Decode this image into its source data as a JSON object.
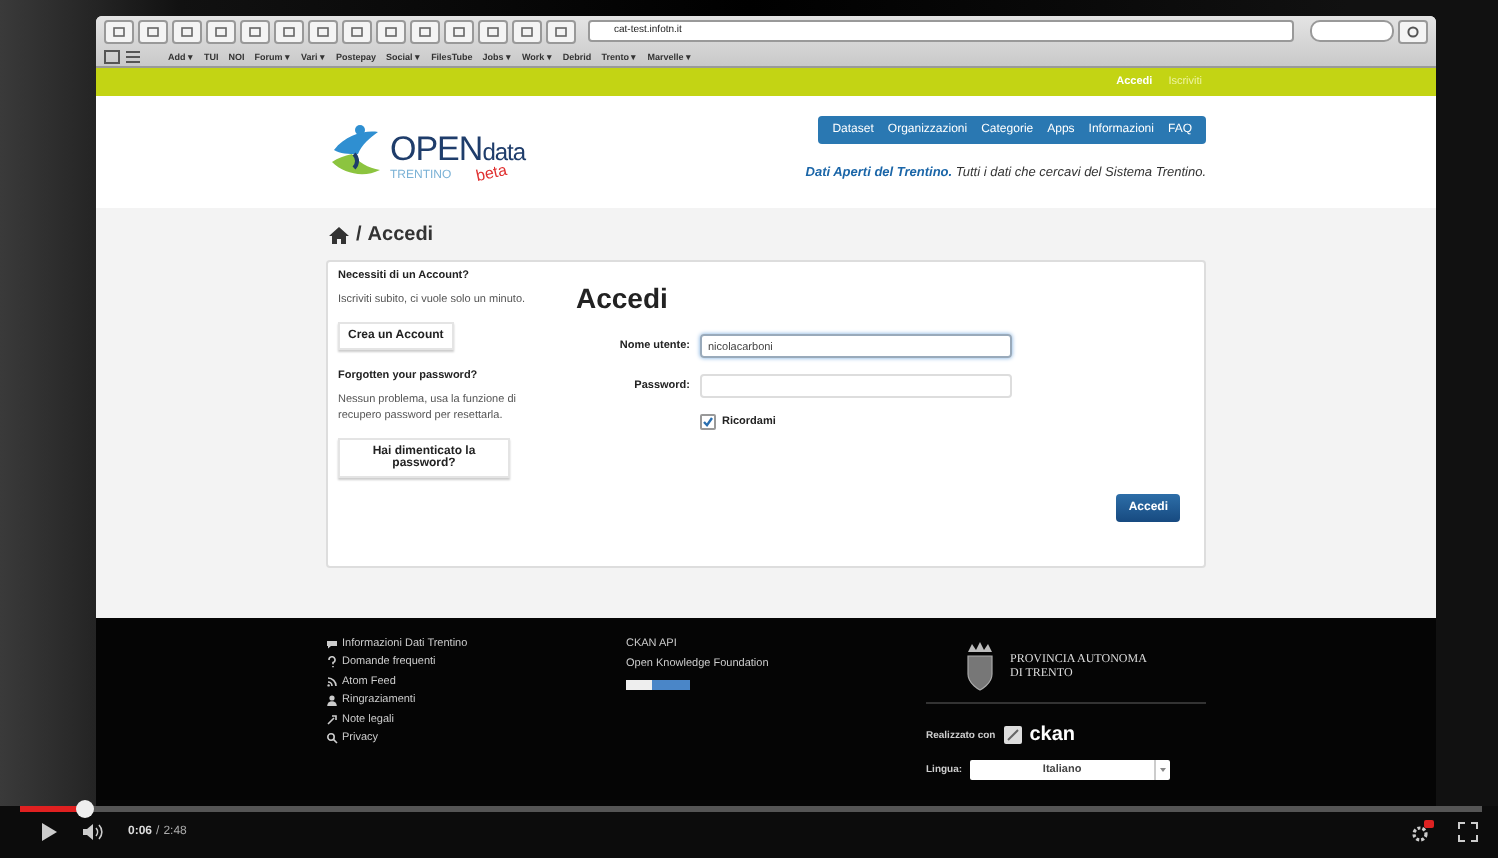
{
  "browser": {
    "url": "cat-test.infotn.it",
    "bookmarks": [
      "Add ▾",
      "TUI",
      "NOI",
      "Forum ▾",
      "Vari ▾",
      "Postepay",
      "Social ▾",
      "FilesTube",
      "Jobs ▾",
      "Work ▾",
      "Debrid",
      "Trento ▾",
      "Marvelle ▾"
    ]
  },
  "topbar": {
    "links": [
      {
        "label": "Accedi",
        "selected": true
      },
      {
        "label": "Iscriviti",
        "selected": false
      }
    ]
  },
  "header": {
    "logo_open": "OPEN",
    "logo_data": "data",
    "logo_region": "TRENTINO",
    "logo_badge": "beta",
    "nav": [
      "Dataset",
      "Organizzazioni",
      "Categorie",
      "Apps",
      "Informazioni",
      "FAQ"
    ],
    "tagline": "**Dati Aperti del Trentino.** Tutti i dati che cercavi del Sistema Trentino."
  },
  "breadcrumb": {
    "separator": "/",
    "current": "Accedi"
  },
  "sidebar": [
    {
      "title": "Necessiti di un Account?",
      "text": "Iscriviti subito, ci vuole solo un minuto.",
      "button": "Crea un Account"
    },
    {
      "title": "Forgotten your password?",
      "text": "Nessun problema, usa la funzione di recupero password per resettarla.",
      "button": "Hai dimenticato la password?"
    }
  ],
  "form": {
    "title": "Accedi",
    "fields": [
      {
        "label": "Nome utente:",
        "value": "nicolacarboni",
        "focused": true
      },
      {
        "label": "Password:",
        "focused": false
      }
    ],
    "remember": {
      "label": "Ricordami",
      "checked": true
    },
    "submit": "Accedi"
  },
  "footer": {
    "links": [
      "Informazioni Dati Trentino",
      "Domande frequenti",
      "Atom Feed",
      "Ringraziamenti",
      "Note legali",
      "Privacy"
    ],
    "links_2": [
      "CKAN API",
      "Open Knowledge Foundation"
    ],
    "province": [
      "PROVINCIA AUTONOMA",
      "DI TRENTO"
    ],
    "made_with": "Realizzato con",
    "ckan": "ckan",
    "language_label": "Lingua:",
    "language": "Italiano"
  },
  "player": {
    "level": 0.045,
    "time_current": "0:06",
    "time_separator": "/",
    "time_total": "2:48"
  }
}
